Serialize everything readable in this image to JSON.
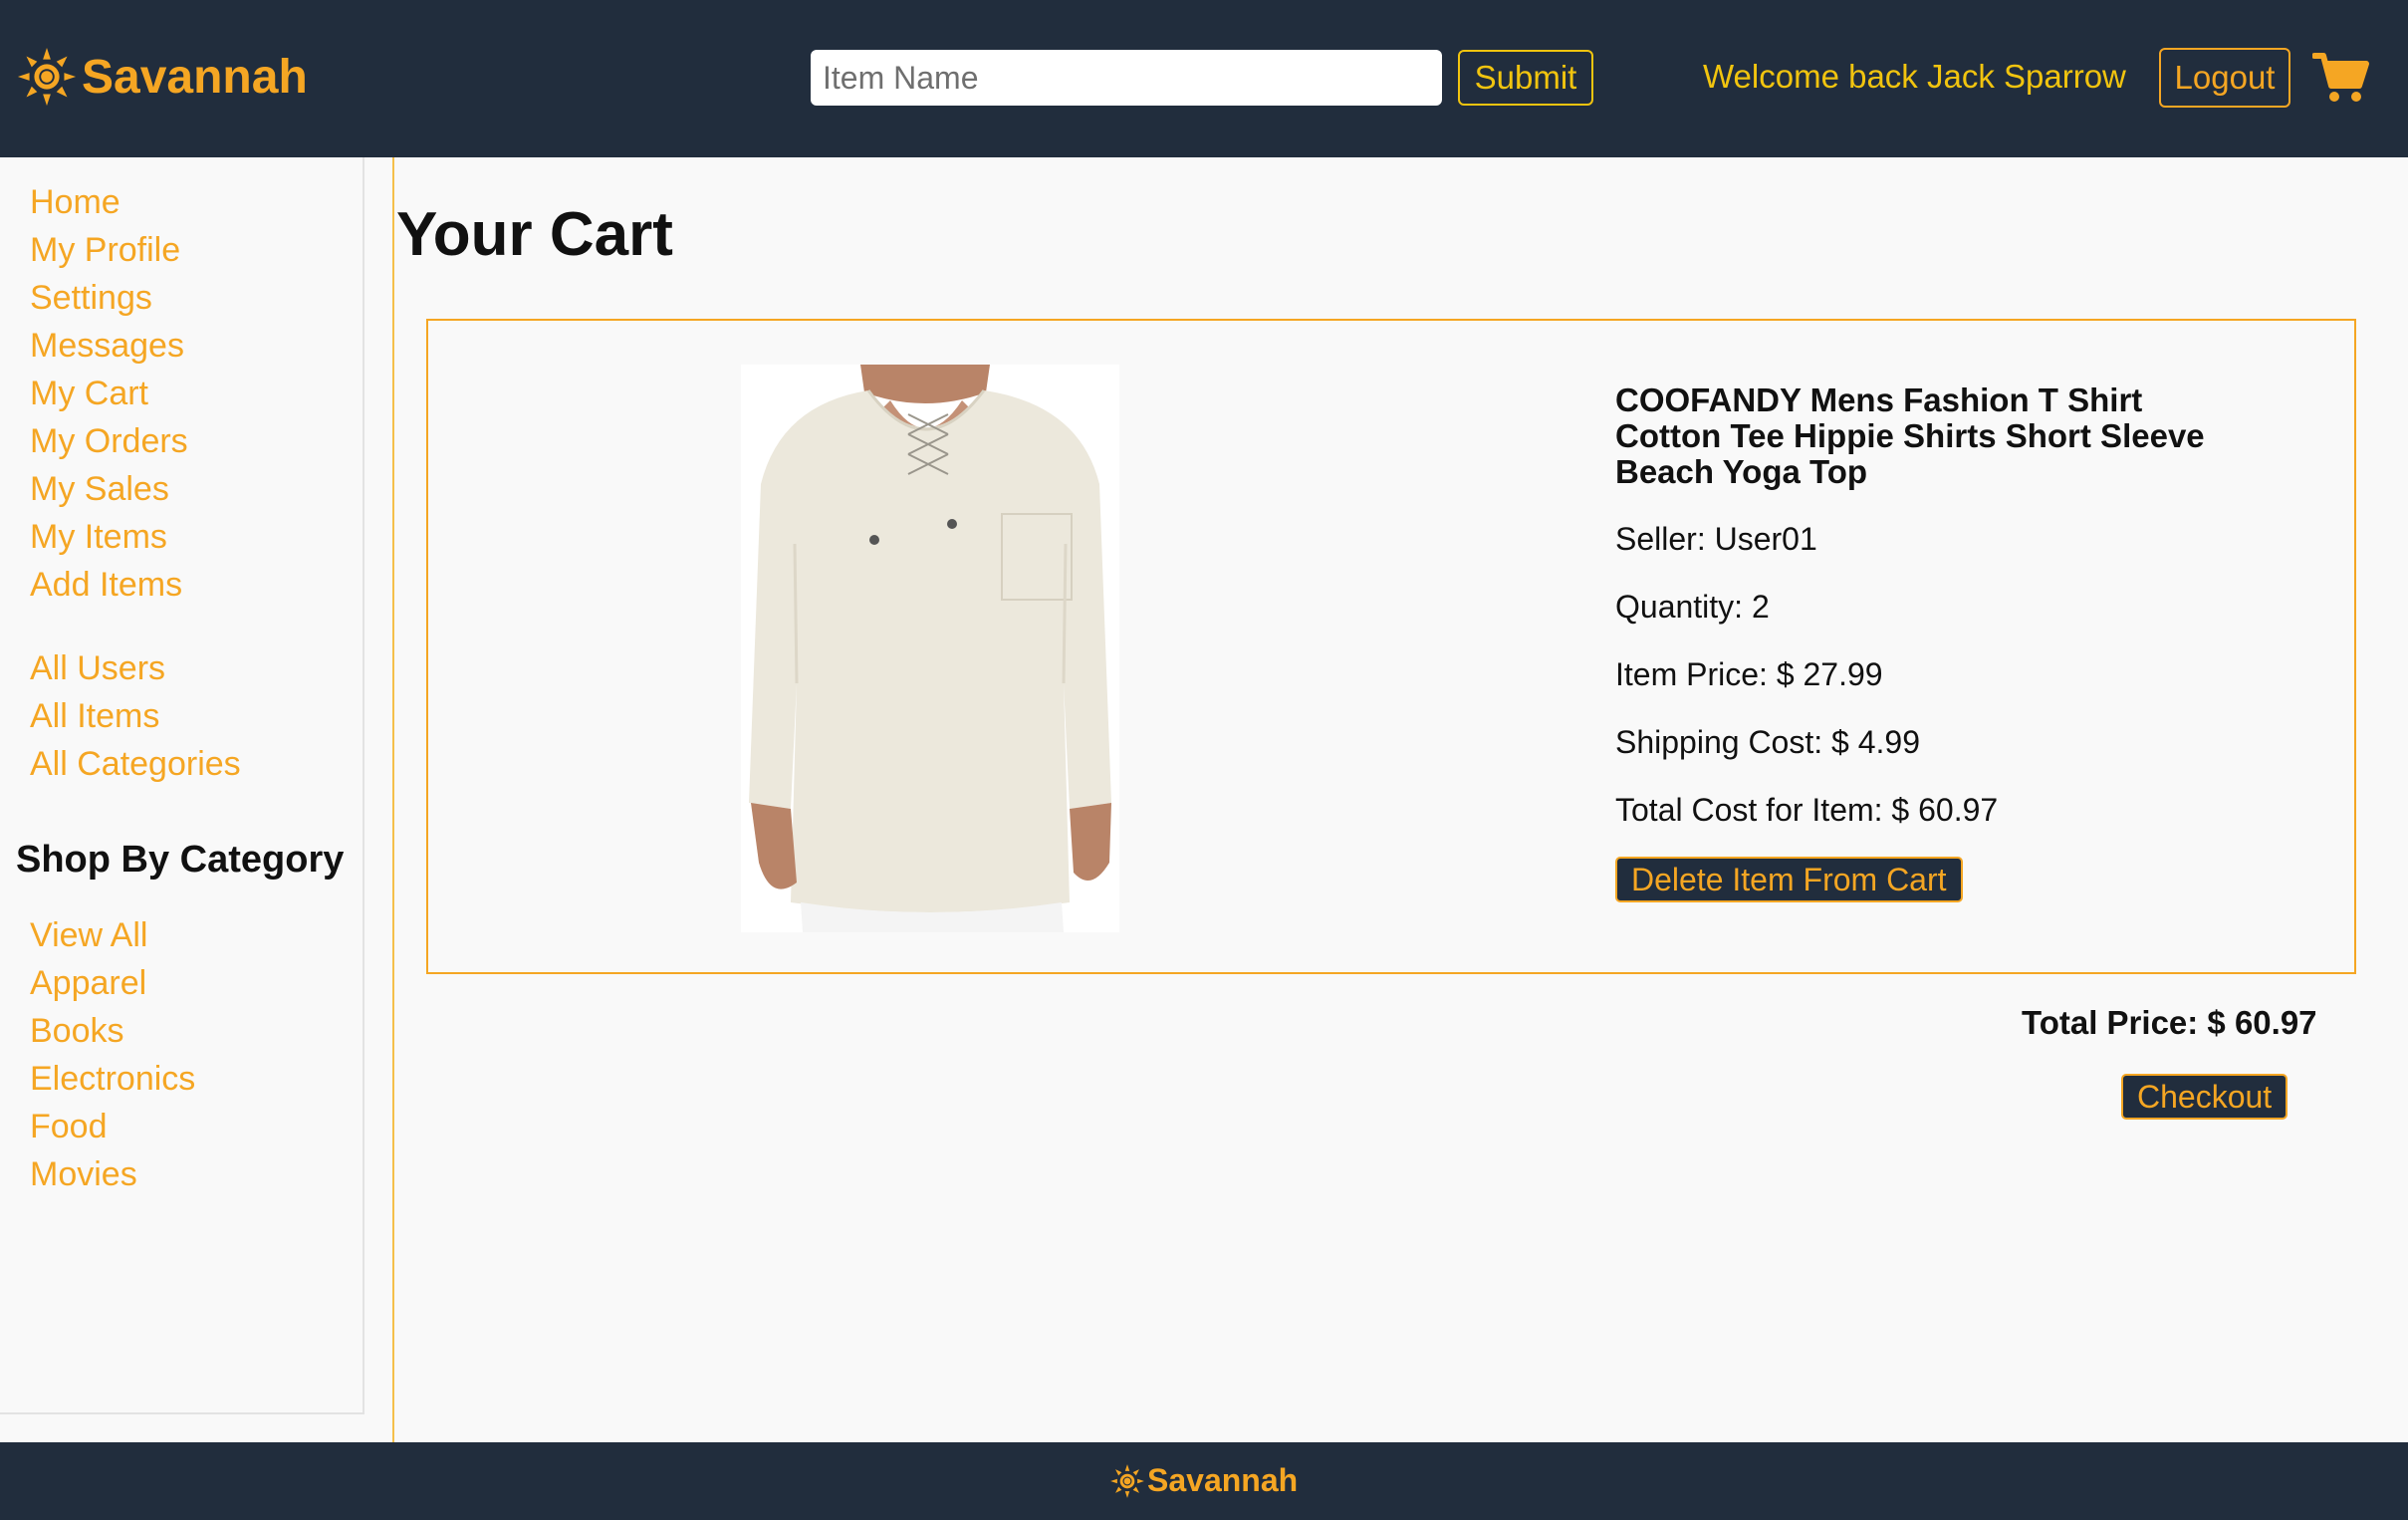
{
  "brand": {
    "name": "Savannah",
    "color": "#f5a623"
  },
  "header": {
    "search_placeholder": "Item Name",
    "submit_label": "Submit",
    "welcome_text": "Welcome back Jack Sparrow",
    "logout_label": "Logout",
    "cart_icon": "cart-icon",
    "background": "#212d3d"
  },
  "sidebar": {
    "account_links": [
      {
        "label": "Home"
      },
      {
        "label": "My Profile"
      },
      {
        "label": "Settings"
      },
      {
        "label": "Messages"
      },
      {
        "label": "My Cart"
      },
      {
        "label": "My Orders"
      },
      {
        "label": "My Sales"
      },
      {
        "label": "My Items"
      },
      {
        "label": "Add Items"
      }
    ],
    "admin_links": [
      {
        "label": "All Users"
      },
      {
        "label": "All Items"
      },
      {
        "label": "All Categories"
      }
    ],
    "category_title": "Shop By Category",
    "category_links": [
      {
        "label": "View All"
      },
      {
        "label": "Apparel"
      },
      {
        "label": "Books"
      },
      {
        "label": "Electronics"
      },
      {
        "label": "Food"
      },
      {
        "label": "Movies"
      }
    ]
  },
  "main": {
    "title": "Your Cart",
    "cart_items": [
      {
        "name": "COOFANDY Mens Fashion T Shirt Cotton Tee Hippie Shirts Short Sleeve Beach Yoga Top",
        "seller_label": "Seller:",
        "seller": "User01",
        "quantity_label": "Quantity:",
        "quantity": "2",
        "item_price_label": "Item Price:",
        "item_price": "$ 27.99",
        "shipping_label": "Shipping Cost:",
        "shipping": "$ 4.99",
        "total_label": "Total Cost for Item:",
        "total": "$ 60.97",
        "delete_label": "Delete Item From Cart"
      }
    ],
    "total_price": "Total Price: $ 60.97",
    "checkout_label": "Checkout"
  },
  "footer": {
    "brand": "Savannah"
  }
}
